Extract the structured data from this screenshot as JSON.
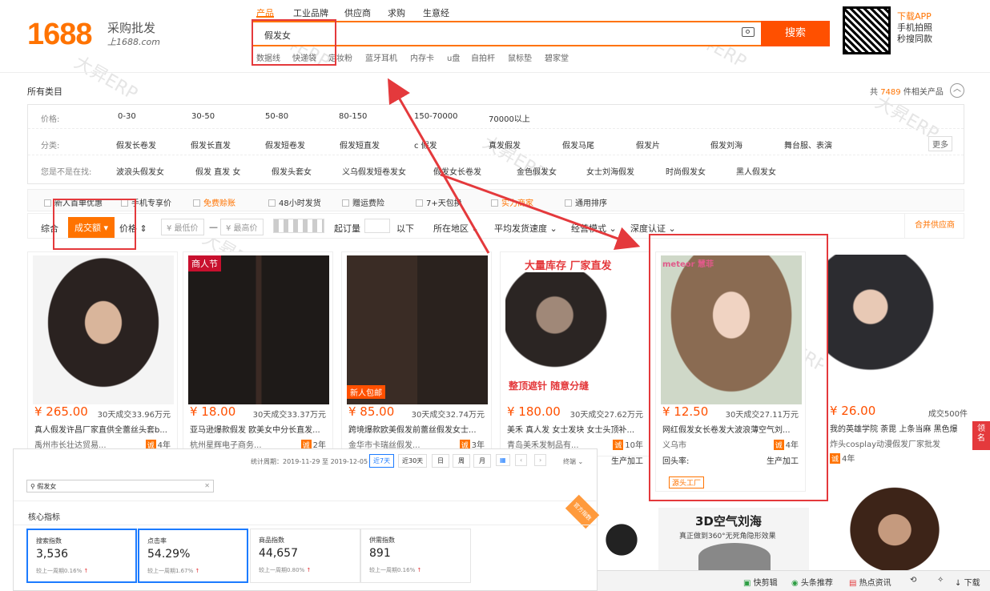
{
  "header": {
    "logo_text": "1688",
    "logo_sub": "采购批发",
    "logo_url": "上1688.com",
    "search_tabs": [
      "产品",
      "工业品牌",
      "供应商",
      "求购",
      "生意经"
    ],
    "search_value": "假发女",
    "search_button": "搜索",
    "hot_words": [
      "数据线",
      "快递袋",
      "定妆粉",
      "蓝牙耳机",
      "内存卡",
      "u盘",
      "自拍杆",
      "鼠标垫",
      "碧家堂"
    ],
    "app_lines": [
      "下载APP",
      "手机拍照",
      "秒搜同款"
    ]
  },
  "category": {
    "label": "所有类目",
    "result_prefix": "共",
    "result_count": "7489",
    "result_suffix": "件相关产品"
  },
  "filters": {
    "price_label": "价格:",
    "prices": [
      "0-30",
      "30-50",
      "50-80",
      "80-150",
      "150-70000",
      "70000以上"
    ],
    "cat_label": "分类:",
    "cats": [
      "假发长卷发",
      "假发长直发",
      "假发短卷发",
      "假发短直发",
      "c  假发",
      "真发假发",
      "假发马尾",
      "假发片",
      "假发刘海",
      "舞台服、表演"
    ],
    "more": "更多",
    "suggest_label": "您是不是在找:",
    "suggest": [
      "波浪头假发女",
      "假发 直发 女",
      "假发头套女",
      "义乌假发短卷发女",
      "假发女长卷发",
      "金色假发女",
      "女士刘海假发",
      "时尚假发女",
      "黑人假发女"
    ]
  },
  "options": [
    "新人首单优惠",
    "手机专享价",
    "免费赊账",
    "48小时发货",
    "赠运费险",
    "7+天包换",
    "实力商家",
    "通用排序"
  ],
  "sort": {
    "general": "综合",
    "volume": "成交额",
    "price": "价格",
    "min_price": "¥ 最低价",
    "dash": "—",
    "max_price": "¥ 最高价",
    "min_order": "起订量",
    "below": "以下",
    "region": "所在地区",
    "ship": "平均发货速度",
    "mode": "经营模式",
    "cert": "深度认证",
    "merge": "合并供应商"
  },
  "products": [
    {
      "price": "¥ 265.00",
      "sold": "30天成交33.96万元",
      "title": "真人假发许昌厂家直供全蕾丝头套b...",
      "shop": "禹州市长壮达贸易...",
      "year": "4年",
      "img": "#2a2220"
    },
    {
      "price": "¥ 18.00",
      "sold": "30天成交33.37万元",
      "title": "亚马逊爆款假发 欧美女中分长直发...",
      "shop": "杭州星辉电子商务...",
      "year": "2年",
      "img": "#1e1a18"
    },
    {
      "price": "¥ 85.00",
      "sold": "30天成交32.74万元",
      "title": "跨境爆款欧美假发前蕾丝假发女士...",
      "shop": "金华市卡瑞丝假发...",
      "year": "3年",
      "img": "#3a2c25"
    },
    {
      "price": "¥ 180.00",
      "sold": "30天成交27.62万元",
      "title": "美禾 真人发 女士发块 女士头顶补...",
      "shop": "青岛美禾发制品有...",
      "year": "10年",
      "img": "#2b2523"
    },
    {
      "price": "¥ 12.50",
      "sold": "30天成交27.11万元",
      "title": "网红假发女长卷发大波浪薄空气刘...",
      "shop": "义乌市",
      "year": "4年",
      "img": "#8a6b52"
    },
    {
      "price": "¥ 26.00",
      "sold": "成交500件",
      "title": "我的英雄学院 荼毘 上条当麻 黑色爆",
      "shop": "炸头cosplay动漫假发厂家批发",
      "year": "4年",
      "img": "#2c2c30"
    }
  ],
  "card5_extra": {
    "repeat": "回头率:",
    "tag": "源头工厂",
    "prod": "生产加工"
  },
  "card4_extra": {
    "prod": "生产加工"
  },
  "promo": {
    "sale_badge": "商人节",
    "stock_banner": "大量库存 厂家直发",
    "bottom_banner": "整顶遮针 随意分缝",
    "new_tag": "新人包邮",
    "air_title": "3D空气刘海",
    "air_sub": "真正做到360°无死角隐形效果",
    "brand": "meteor 慧菲"
  },
  "analytics": {
    "period_label": "统计周期：2019-11-29 至 2019-12-05",
    "tabs": [
      "近7天",
      "近30天",
      "日",
      "周",
      "月"
    ],
    "terminal": "终端",
    "search_value": "假发女",
    "section_title": "核心指标",
    "corner": "官方指数",
    "kpis": [
      {
        "name": "搜索指数",
        "value": "3,536",
        "compare": "较上一周期0.16%"
      },
      {
        "name": "点击率",
        "value": "54.29%",
        "compare": "较上一周期1.67%"
      },
      {
        "name": "商品指数",
        "value": "44,657",
        "compare": "较上一周期0.80%"
      },
      {
        "name": "供需指数",
        "value": "891",
        "compare": "较上一周期0.16%"
      }
    ]
  },
  "taskbar": [
    "快剪辑",
    "头条推荐",
    "热点资讯",
    "下载"
  ],
  "watermark": "大昇ERP",
  "colors": {
    "brand": "#ff7300",
    "price": "#ff5000",
    "highlight": "#e4393c",
    "kpi_border": "#1c7bff"
  }
}
